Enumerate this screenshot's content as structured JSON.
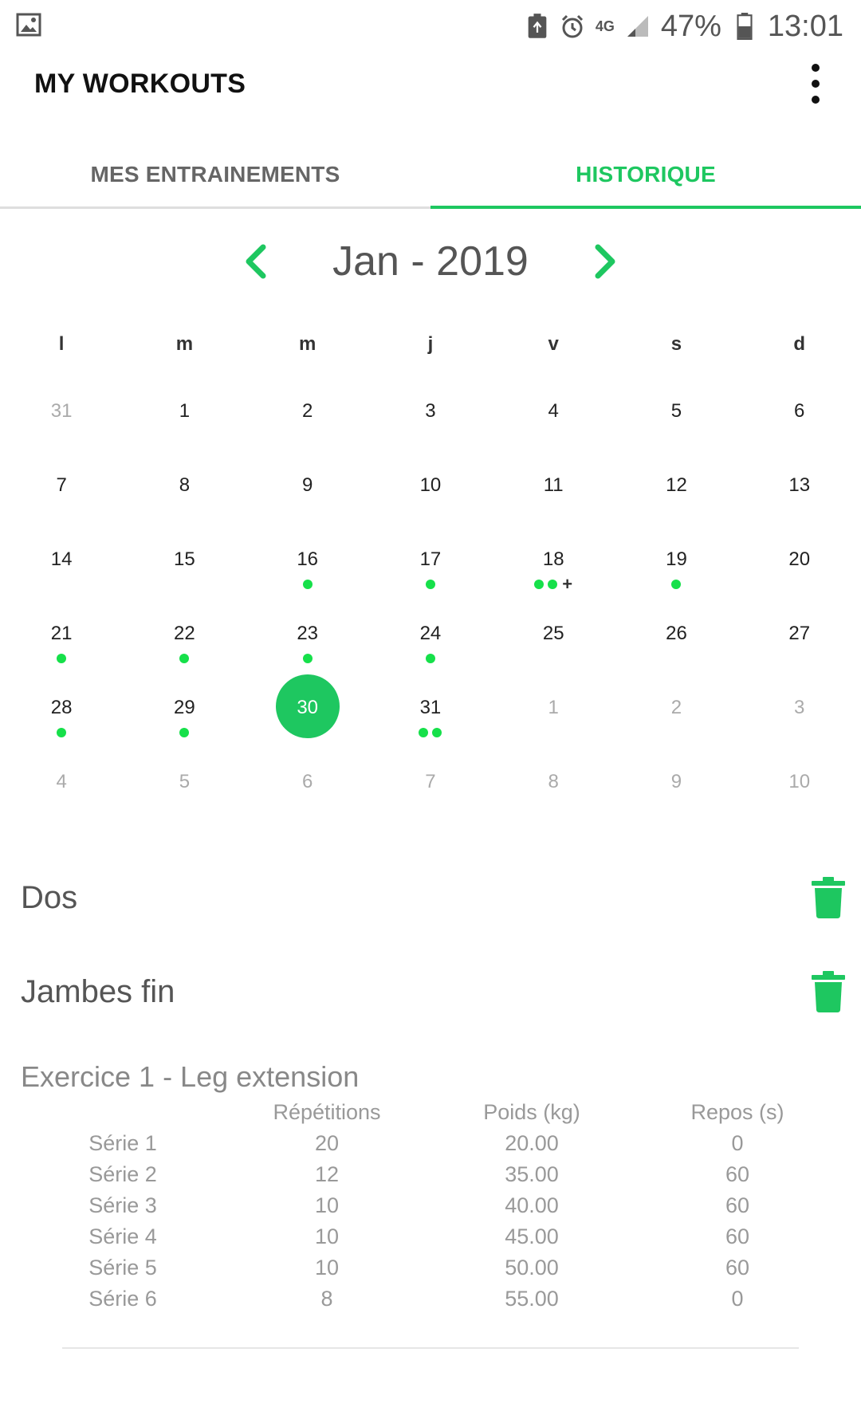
{
  "status_bar": {
    "signal_label": "4G",
    "battery_percent": "47%",
    "time": "13:01"
  },
  "app_bar": {
    "title": "MY WORKOUTS"
  },
  "tabs": [
    {
      "label": "MES ENTRAINEMENTS",
      "active": false
    },
    {
      "label": "HISTORIQUE",
      "active": true
    }
  ],
  "calendar": {
    "month_label": "Jan - 2019",
    "weekdays": [
      "l",
      "m",
      "m",
      "j",
      "v",
      "s",
      "d"
    ],
    "weeks": [
      [
        {
          "d": "31",
          "other": true,
          "dots": 0
        },
        {
          "d": "1",
          "dots": 0
        },
        {
          "d": "2",
          "dots": 0
        },
        {
          "d": "3",
          "dots": 0
        },
        {
          "d": "4",
          "dots": 0
        },
        {
          "d": "5",
          "dots": 0
        },
        {
          "d": "6",
          "dots": 0
        }
      ],
      [
        {
          "d": "7",
          "dots": 0
        },
        {
          "d": "8",
          "dots": 0
        },
        {
          "d": "9",
          "dots": 0
        },
        {
          "d": "10",
          "dots": 0
        },
        {
          "d": "11",
          "dots": 0
        },
        {
          "d": "12",
          "dots": 0
        },
        {
          "d": "13",
          "dots": 0
        }
      ],
      [
        {
          "d": "14",
          "dots": 0
        },
        {
          "d": "15",
          "dots": 0
        },
        {
          "d": "16",
          "dots": 1
        },
        {
          "d": "17",
          "dots": 1
        },
        {
          "d": "18",
          "dots": 2,
          "plus": "+"
        },
        {
          "d": "19",
          "dots": 1
        },
        {
          "d": "20",
          "dots": 0
        }
      ],
      [
        {
          "d": "21",
          "dots": 1
        },
        {
          "d": "22",
          "dots": 1
        },
        {
          "d": "23",
          "dots": 1
        },
        {
          "d": "24",
          "dots": 1
        },
        {
          "d": "25",
          "dots": 0
        },
        {
          "d": "26",
          "dots": 0
        },
        {
          "d": "27",
          "dots": 0
        }
      ],
      [
        {
          "d": "28",
          "dots": 1
        },
        {
          "d": "29",
          "dots": 1
        },
        {
          "d": "30",
          "dots": 0,
          "selected": true
        },
        {
          "d": "31",
          "dots": 2
        },
        {
          "d": "1",
          "other": true,
          "dots": 0
        },
        {
          "d": "2",
          "other": true,
          "dots": 0
        },
        {
          "d": "3",
          "other": true,
          "dots": 0
        }
      ],
      [
        {
          "d": "4",
          "other": true,
          "dots": 0
        },
        {
          "d": "5",
          "other": true,
          "dots": 0
        },
        {
          "d": "6",
          "other": true,
          "dots": 0
        },
        {
          "d": "7",
          "other": true,
          "dots": 0
        },
        {
          "d": "8",
          "other": true,
          "dots": 0
        },
        {
          "d": "9",
          "other": true,
          "dots": 0
        },
        {
          "d": "10",
          "other": true,
          "dots": 0
        }
      ]
    ]
  },
  "workouts": [
    {
      "title": "Dos"
    },
    {
      "title": "Jambes fin"
    }
  ],
  "exercise": {
    "title": "Exercice 1 - Leg extension",
    "headers": [
      "",
      "Répétitions",
      "Poids (kg)",
      "Repos (s)"
    ],
    "rows": [
      [
        "Série 1",
        "20",
        "20.00",
        "0"
      ],
      [
        "Série 2",
        "12",
        "35.00",
        "60"
      ],
      [
        "Série 3",
        "10",
        "40.00",
        "60"
      ],
      [
        "Série 4",
        "10",
        "45.00",
        "60"
      ],
      [
        "Série 5",
        "10",
        "50.00",
        "60"
      ],
      [
        "Série 6",
        "8",
        "55.00",
        "0"
      ]
    ]
  },
  "colors": {
    "accent": "#1ec760",
    "dot": "#16e04a"
  }
}
